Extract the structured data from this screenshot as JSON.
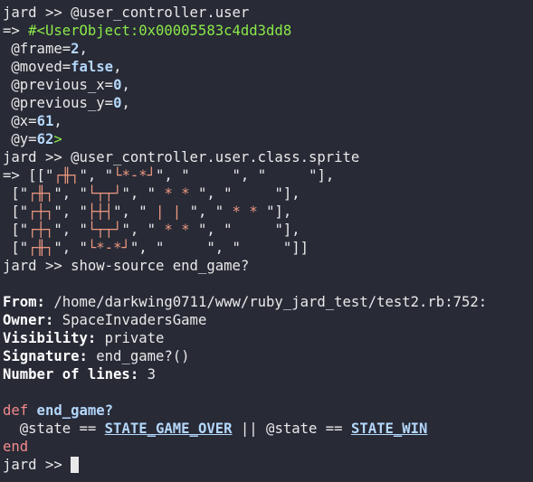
{
  "terminal": {
    "l1": "jard >> @user_controller.user",
    "l2_arrow": "=> ",
    "l2_obj": "#<UserObject:0x00005583c4dd3dd8",
    "l3_a": " @frame=",
    "l3_v": "2",
    "l3_c": ",",
    "l4_a": " @moved=",
    "l4_v": "false",
    "l4_c": ",",
    "l5_a": " @previous_x=",
    "l5_v": "0",
    "l5_c": ",",
    "l6_a": " @previous_y=",
    "l6_v": "0",
    "l6_c": ",",
    "l7_a": " @x=",
    "l7_v": "61",
    "l7_c": ",",
    "l8_a": " @y=",
    "l8_v": "62",
    "l8_c": ">",
    "l9": "jard >> @user_controller.user.class.sprite",
    "sprite": [
      {
        "pre": "=> [[\"",
        "cells": [
          "┌╫┐",
          "└*-*┘",
          "     ",
          "     "
        ],
        "post": "\"],"
      },
      {
        "pre": " [\"",
        "cells": [
          "┌╫┐",
          "└┬┬┘",
          " * * ",
          "     "
        ],
        "post": "\"],"
      },
      {
        "pre": " [\"",
        "cells": [
          "┌┼┐",
          "├┼┤",
          " | | ",
          " * * "
        ],
        "post": "\"],"
      },
      {
        "pre": " [\"",
        "cells": [
          "┌┼┐",
          "└┬┬┘",
          " * * ",
          "     "
        ],
        "post": "\"],"
      },
      {
        "pre": " [\"",
        "cells": [
          "┌╫┐",
          "└*-*┘",
          "     ",
          "     "
        ],
        "post": "\"]]"
      }
    ],
    "l15": "jard >> show-source end_game?",
    "from_label": "From:",
    "from_value": " /home/darkwing0711/www/ruby_jard_test/test2.rb:752:",
    "owner_label": "Owner:",
    "owner_value": " SpaceInvadersGame",
    "vis_label": "Visibility:",
    "vis_value": " private",
    "sig_label": "Signature:",
    "sig_value": " end_game?()",
    "lines_label": "Number of lines:",
    "lines_value": " 3",
    "def_kw": "def",
    "def_name": " end_game?",
    "body_a": "  @state == ",
    "const1": "STATE_GAME_OVER",
    "body_b": " || @state == ",
    "const2": "STATE_WIN",
    "end_kw": "end",
    "prompt": "jard >> "
  },
  "colors": {
    "background": "#282a36",
    "green": "#8be94a",
    "blue": "#b4d7fb",
    "salmon": "#ef9a80",
    "keyword": "#f28a8a"
  }
}
